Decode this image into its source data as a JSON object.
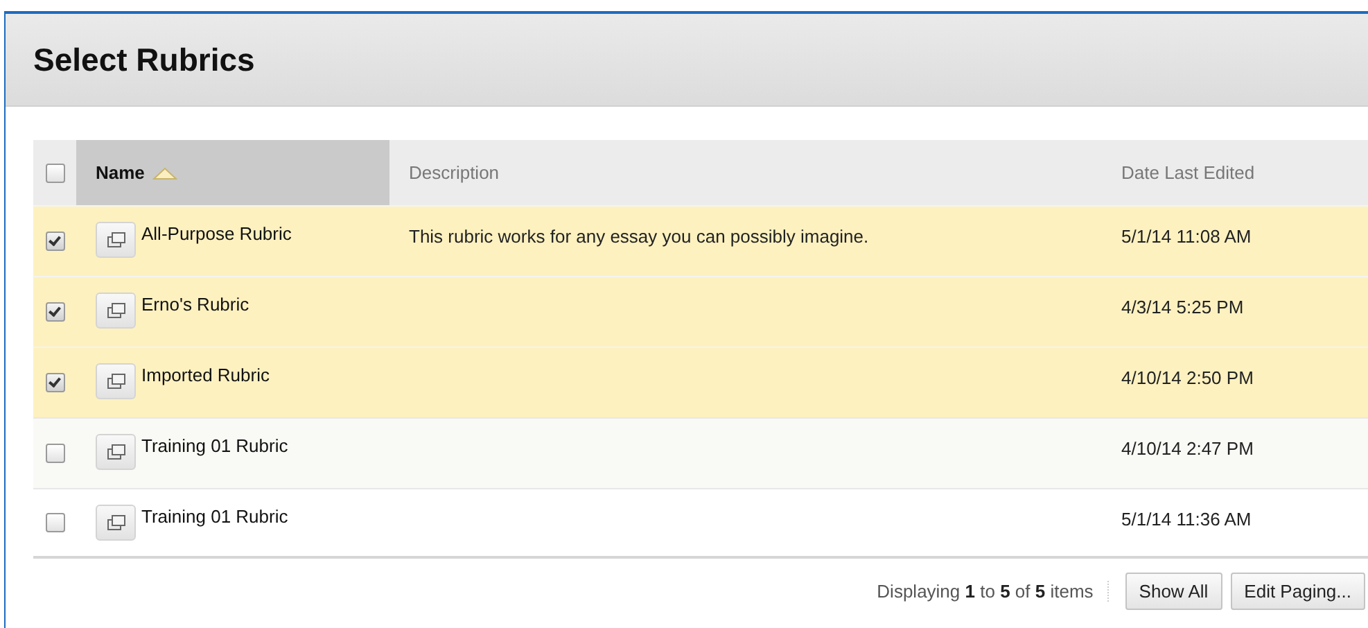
{
  "title": "Select Rubrics",
  "table": {
    "select_all": {
      "checked": false
    },
    "columns": [
      {
        "label": "Name",
        "sorted": true
      },
      {
        "label": "Description",
        "sorted": false
      },
      {
        "label": "Date Last Edited",
        "sorted": false
      }
    ],
    "rows": [
      {
        "selected": true,
        "name": "All-Purpose Rubric",
        "description": "This rubric works for any essay you can possibly imagine.",
        "date": "5/1/14 11:08 AM"
      },
      {
        "selected": true,
        "name": "Erno's Rubric",
        "date": "4/3/14 5:25 PM"
      },
      {
        "selected": true,
        "name": "Imported Rubric",
        "date": "4/10/14 2:50 PM"
      },
      {
        "selected": false,
        "name": "Training 01 Rubric",
        "date": "4/10/14 2:47 PM"
      },
      {
        "selected": false,
        "name": "Training 01 Rubric",
        "date": "5/1/14 11:36 AM"
      }
    ]
  },
  "paging": {
    "summary": "Displaying **1** to **5** of **5** items",
    "buttons": [
      "Show All",
      "Edit Paging..."
    ]
  }
}
